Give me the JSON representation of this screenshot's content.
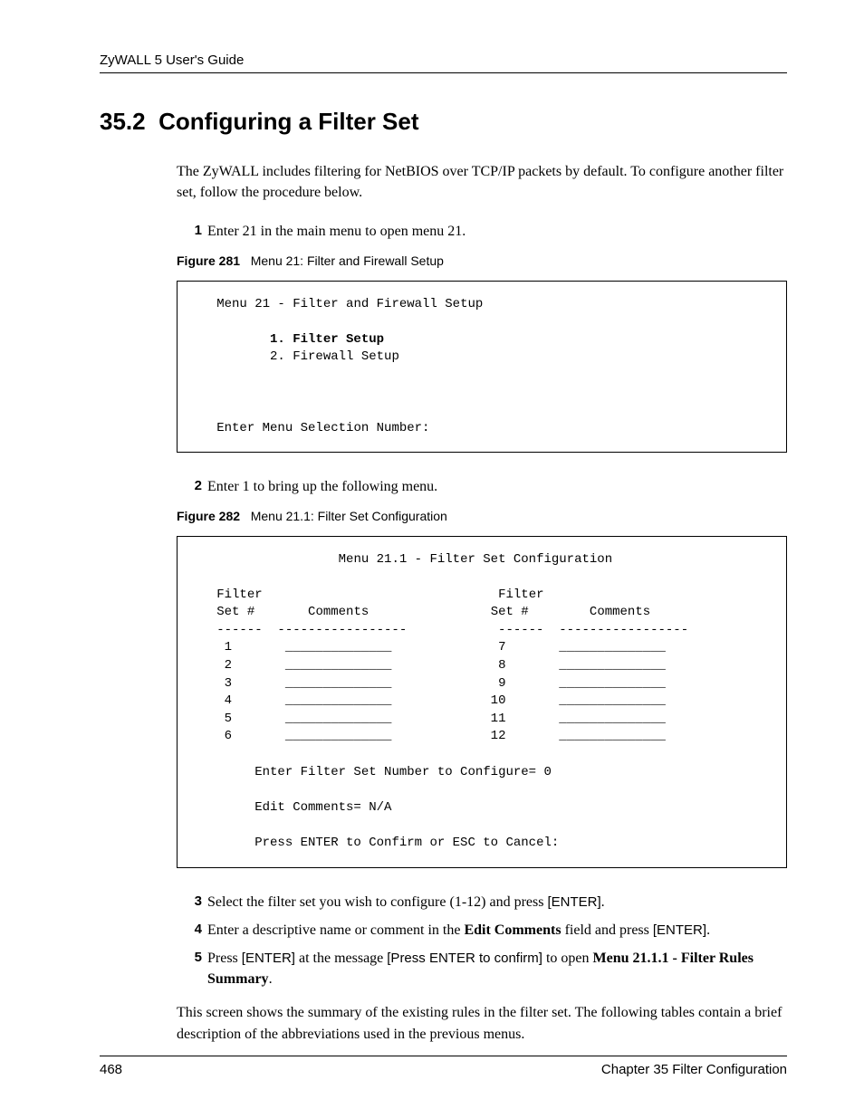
{
  "header": "ZyWALL 5 User's Guide",
  "section": {
    "number": "35.2",
    "title": "Configuring a Filter Set"
  },
  "intro": "The ZyWALL includes filtering for NetBIOS over TCP/IP packets by default. To configure another filter set, follow the procedure below.",
  "step1": {
    "num": "1",
    "text": "Enter 21 in the main menu to open menu 21."
  },
  "figure281": {
    "label": "Figure 281",
    "caption": "Menu 21: Filter and Firewall Setup",
    "line_title": "Menu 21 - Filter and Firewall Setup",
    "line_item1": "1. Filter Setup",
    "line_item2": "2. Firewall Setup",
    "line_prompt": "Enter Menu Selection Number:"
  },
  "step2": {
    "num": "2",
    "text": "Enter 1 to bring up the following menu."
  },
  "figure282": {
    "label": "Figure 282",
    "caption": "Menu 21.1: Filter Set Configuration",
    "title": "Menu 21.1 - Filter Set Configuration",
    "header_left_l1": "Filter",
    "header_left_l2": "Set #",
    "header_comments": "Comments",
    "header_right_l1": "Filter",
    "header_right_l2": "Set #",
    "header_comments2": "Comments",
    "rows_left": [
      "1",
      "2",
      "3",
      "4",
      "5",
      "6"
    ],
    "rows_right": [
      "7",
      "8",
      "9",
      "10",
      "11",
      "12"
    ],
    "prompt1": "Enter Filter Set Number to Configure= 0",
    "prompt2": "Edit Comments= N/A",
    "prompt3": "Press ENTER to Confirm or ESC to Cancel:"
  },
  "step3": {
    "num": "3",
    "text_a": "Select the filter set you wish to configure (1-12) and press ",
    "enter": "[ENTER]",
    "period": "."
  },
  "step4": {
    "num": "4",
    "text_a": "Enter a descriptive name or comment in the ",
    "bold": "Edit Comments",
    "text_b": " field and press ",
    "enter": "[ENTER]",
    "period": "."
  },
  "step5": {
    "num": "5",
    "text_a": "Press ",
    "enter1": "[ENTER]",
    "text_b": " at the message ",
    "msg": "[Press ENTER to confirm]",
    "text_c": " to open ",
    "bold": "Menu 21.1.1 - Filter Rules Summary",
    "period": "."
  },
  "outro": "This screen shows the summary of the existing rules in the filter set. The following tables contain a brief description of the abbreviations used in the previous menus.",
  "footer": {
    "page": "468",
    "chapter": "Chapter 35 Filter Configuration"
  }
}
